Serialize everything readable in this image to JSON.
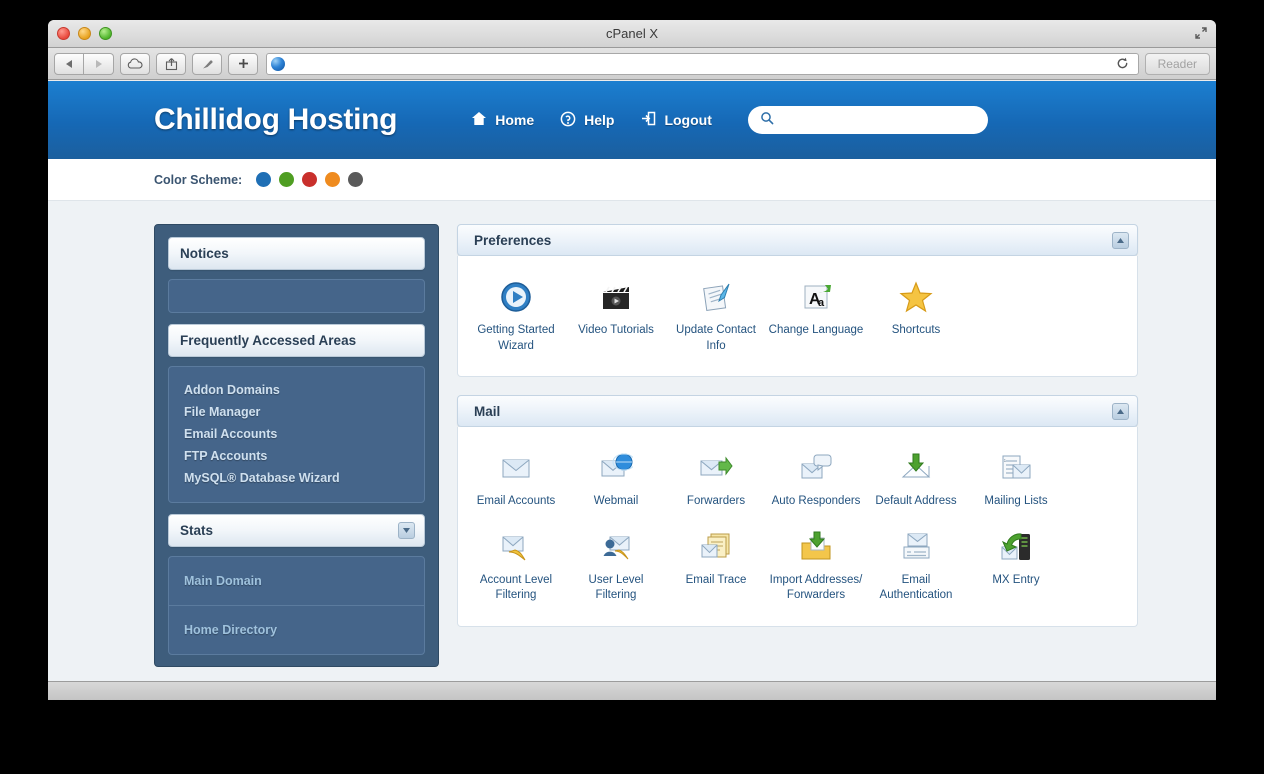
{
  "window": {
    "title": "cPanel X",
    "traffic_lights": [
      "close",
      "minimize",
      "maximize"
    ],
    "toolbar": {
      "back_label": "◀",
      "forward_label": "▶",
      "icloud_icon": "cloud-icon",
      "share_icon": "share-icon",
      "bookmark_icon": "bookmark-icon",
      "newtab_label": "+",
      "url_value": "",
      "url_placeholder": "",
      "reload_label": "↻",
      "reader_label": "Reader"
    }
  },
  "header": {
    "brand": "Chillidog Hosting",
    "nav": [
      {
        "label": "Home",
        "icon": "home-icon"
      },
      {
        "label": "Help",
        "icon": "help-icon"
      },
      {
        "label": "Logout",
        "icon": "logout-icon"
      }
    ],
    "search": {
      "value": "",
      "placeholder": "",
      "icon": "search-icon"
    }
  },
  "color_scheme": {
    "label": "Color Scheme:",
    "colors": [
      "#1f6fb5",
      "#4f9e22",
      "#c9302c",
      "#ef8b1f",
      "#5a5a5a"
    ]
  },
  "sidebar": {
    "notices": {
      "title": "Notices",
      "items": []
    },
    "frequently_accessed": {
      "title": "Frequently Accessed Areas",
      "items": [
        "Addon Domains",
        "File Manager",
        "Email Accounts",
        "FTP Accounts",
        "MySQL® Database Wizard"
      ]
    },
    "stats": {
      "title": "Stats",
      "toggle": "▼",
      "items": [
        "Main Domain",
        "Home Directory"
      ]
    }
  },
  "sections": [
    {
      "title": "Preferences",
      "toggle": "▲",
      "tiles": [
        {
          "label": "Getting Started Wizard",
          "icon": "play-button-icon"
        },
        {
          "label": "Video Tutorials",
          "icon": "film-clapper-icon"
        },
        {
          "label": "Update Contact Info",
          "icon": "notepad-pen-icon"
        },
        {
          "label": "Change Language",
          "icon": "language-aa-icon"
        },
        {
          "label": "Shortcuts",
          "icon": "star-icon"
        }
      ]
    },
    {
      "title": "Mail",
      "toggle": "▲",
      "tiles": [
        {
          "label": "Email Accounts",
          "icon": "envelope-icon"
        },
        {
          "label": "Webmail",
          "icon": "envelope-globe-icon"
        },
        {
          "label": "Forwarders",
          "icon": "envelope-arrow-icon"
        },
        {
          "label": "Auto Responders",
          "icon": "envelope-bubble-icon"
        },
        {
          "label": "Default Address",
          "icon": "envelope-download-icon"
        },
        {
          "label": "Mailing Lists",
          "icon": "list-envelope-icon"
        },
        {
          "label": "Account Level Filtering",
          "icon": "envelope-funnel-icon"
        },
        {
          "label": "User Level Filtering",
          "icon": "user-funnel-icon"
        },
        {
          "label": "Email Trace",
          "icon": "envelope-pages-icon"
        },
        {
          "label": "Import Addresses/ Forwarders",
          "icon": "import-folder-icon"
        },
        {
          "label": "Email Authentication",
          "icon": "envelope-form-icon"
        },
        {
          "label": "MX Entry",
          "icon": "server-arrow-icon"
        }
      ]
    }
  ]
}
